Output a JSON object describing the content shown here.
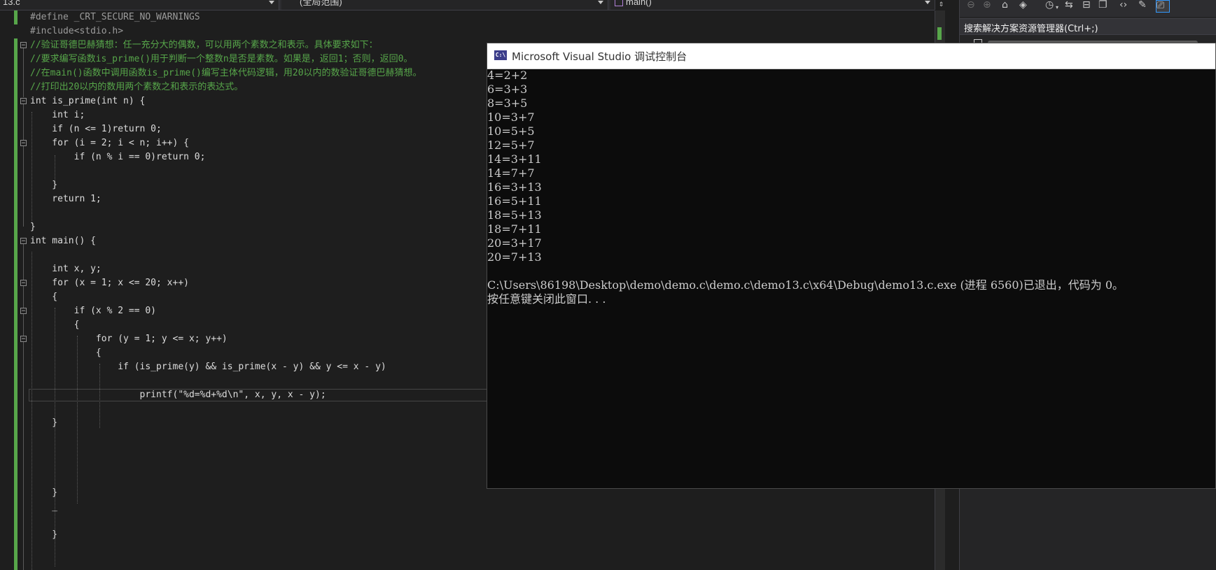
{
  "nav": {
    "file_dropdown": "13.c",
    "scope_dropdown": "(全局范围)",
    "function_dropdown": "main()"
  },
  "code_lines": [
    "#define _CRT_SECURE_NO_WARNINGS",
    "#include<stdio.h>",
    "//验证哥德巴赫猜想：任一充分大的偶数，可以用两个素数之和表示。具体要求如下：",
    "//要求编写函数is_prime()用于判断一个整数n是否是素数。如果是，返回1；否则，返回0。",
    "//在main()函数中调用函数is_prime()编写主体代码逻辑，用20以内的数验证哥德巴赫猜想。",
    "//打印出20以内的数用两个素数之和表示的表达式。",
    "int is_prime(int n) {",
    "    int i;",
    "    if (n <= 1)return 0;",
    "    for (i = 2; i < n; i++) {",
    "        if (n % i == 0)return 0;",
    "",
    "    }",
    "    return 1;",
    "",
    "}",
    "int main() {",
    "",
    "    int x, y;",
    "    for (x = 1; x <= 20; x++)",
    "    {",
    "        if (x % 2 == 0)",
    "        {",
    "            for (y = 1; y <= x; y++)",
    "            {",
    "                if (is_prime(y) && is_prime(x - y) && y <= x - y)",
    "",
    "                    printf(\"%d=%d+%d\\n\", x, y, x - y);",
    "",
    "    }",
    "",
    "",
    "",
    "",
    "    }",
    "    _",
    "",
    "    }"
  ],
  "solution_explorer": {
    "search_label": "搜索解决方案资源管理器(Ctrl+;)"
  },
  "console": {
    "title": "Microsoft Visual Studio 调试控制台",
    "icon_text": "C:\\",
    "output_lines": [
      "4=2+2",
      "6=3+3",
      "8=3+5",
      "10=3+7",
      "10=5+5",
      "12=5+7",
      "14=3+11",
      "14=7+7",
      "16=3+13",
      "16=5+11",
      "18=5+13",
      "18=7+11",
      "20=3+17",
      "20=7+13",
      "",
      "C:\\Users\\86198\\Desktop\\demo\\demo.c\\demo.c\\demo13.c\\x64\\Debug\\demo13.c.exe (进程 6560)已退出，代码为 0。",
      "按任意键关闭此窗口. . ."
    ]
  }
}
